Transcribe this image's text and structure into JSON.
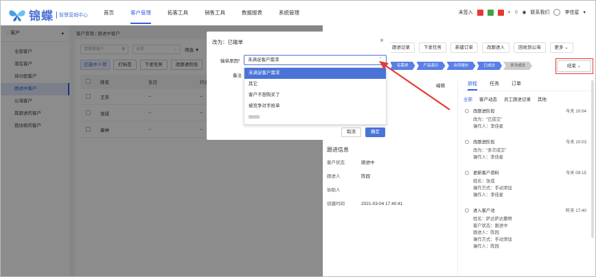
{
  "header": {
    "brand": "锦蝶",
    "subtitle": "智慧营销中心",
    "nav": [
      "首页",
      "客户管理",
      "拓客工具",
      "销售工具",
      "数据报表",
      "系统管理"
    ],
    "not_signed": "未签入",
    "contact": "联系我们",
    "user": "李佳星"
  },
  "sidebar": {
    "title": "客户",
    "items": [
      "全部客户",
      "潜在客户",
      "待分配客户",
      "跟进中客户",
      "公海客户",
      "我跟进的客户",
      "我协助的客户"
    ]
  },
  "list": {
    "breadcrumb": "客户管理 / 跟进中客户",
    "search_placeholder": "请搜索客户",
    "select_all": "全部",
    "filter": "筛选",
    "selected": "已选中 0 项",
    "btn_tag": "打标签",
    "btn_task": "下发任务",
    "btn_change": "改跟进阶段",
    "cols": [
      "姓名",
      "生日",
      "行业"
    ],
    "rows": [
      [
        "王芳",
        "--",
        "--"
      ],
      [
        "张成",
        "--",
        "--"
      ],
      [
        "秦林",
        "--",
        "--"
      ]
    ]
  },
  "drawer": {
    "actions": [
      "跟进记录",
      "下发任务",
      "新建订单",
      "改跟进人",
      "回收到公海",
      "更多"
    ],
    "steps": [
      "有需求",
      "产品演示",
      "合同报价",
      "已成交",
      "多次成交"
    ],
    "end": "结束",
    "edit": "编辑",
    "section": "跟进信息",
    "fields": [
      {
        "k": "客户状态",
        "v": "跟进中"
      },
      {
        "k": "跟进人",
        "v": "陈园"
      },
      {
        "k": "协助人",
        "v": ""
      },
      {
        "k": "创建时间",
        "v": "2021-03-04 17:40:41"
      }
    ],
    "rtabs": [
      "旅程",
      "任务",
      "订单"
    ],
    "rsub": [
      "全部",
      "客户动态",
      "员工跟进记录",
      "其他"
    ],
    "events": [
      {
        "t": "改跟进阶段",
        "tm": "今天 10:04",
        "d": [
          "改为：“已成交”",
          "操作人：李佳星"
        ]
      },
      {
        "t": "改跟进阶段",
        "tm": "今天 10:03",
        "d": [
          "改为：“多次成交”",
          "操作人：李佳星"
        ]
      },
      {
        "t": "更新客户资料",
        "tm": "今天 09:15",
        "d": [
          "姓名：张成",
          "操作方式：手动添加",
          "操作人：李佳星"
        ]
      },
      {
        "t": "进入客户池",
        "tm": "昨天 17:40",
        "d": [
          "姓名：萨达萨达撒啊",
          "客户状态：跟进中",
          "跟进人：陈园",
          "操作方式：手动添加",
          "操作人：陈园"
        ]
      }
    ]
  },
  "modal": {
    "title": "改为：已输单",
    "reason_label": "输单原因*",
    "reason_value": "未满足客户需求",
    "note_label": "备注",
    "cancel": "取消",
    "ok": "确定",
    "options": [
      "未满足客户需求",
      "其它",
      "客户不想购买了",
      "被竞争对手抢单"
    ]
  },
  "colors": {
    "accent": "#4a73d8",
    "red": "#e53935"
  }
}
